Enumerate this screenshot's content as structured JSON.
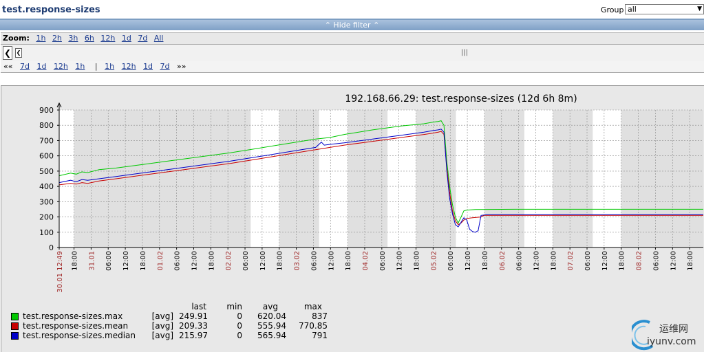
{
  "header": {
    "title": "test.response-sizes",
    "group_label": "Group",
    "group_value": "all"
  },
  "filterbar": {
    "label": "⌃ Hide filter ⌃"
  },
  "zoom": {
    "label": "Zoom:",
    "options": [
      "1h",
      "2h",
      "3h",
      "6h",
      "12h",
      "1d",
      "7d",
      "All"
    ]
  },
  "nav": {
    "back": "««",
    "back_options": [
      "7d",
      "1d",
      "12h",
      "1h"
    ],
    "separator": "|",
    "fwd_options": [
      "1h",
      "12h",
      "1d",
      "7d"
    ],
    "forward": "»»"
  },
  "colors": {
    "max": "#00c800",
    "mean": "#c80000",
    "median": "#0000c8",
    "day_label": "#a02828",
    "grid_band": "#e0e0e0"
  },
  "chart_data": {
    "type": "line",
    "title": "192.168.66.29: test.response-sizes (12d 6h 8m)",
    "ylim": [
      0,
      900
    ],
    "yticks": [
      0,
      100,
      200,
      300,
      400,
      500,
      600,
      700,
      800,
      900
    ],
    "grid": true,
    "xlabels": [
      {
        "t": 0.0,
        "text": "30.01 12:49",
        "day": true
      },
      {
        "t": 5.2,
        "text": "18:00",
        "day": false
      },
      {
        "t": 11.2,
        "text": "31.01",
        "day": true
      },
      {
        "t": 17.2,
        "text": "06:00",
        "day": false
      },
      {
        "t": 23.2,
        "text": "12:00",
        "day": false
      },
      {
        "t": 29.2,
        "text": "18:00",
        "day": false
      },
      {
        "t": 35.2,
        "text": "01.02",
        "day": true
      },
      {
        "t": 41.2,
        "text": "06:00",
        "day": false
      },
      {
        "t": 47.2,
        "text": "12:00",
        "day": false
      },
      {
        "t": 53.2,
        "text": "18:00",
        "day": false
      },
      {
        "t": 59.2,
        "text": "02.02",
        "day": true
      },
      {
        "t": 65.2,
        "text": "06:00",
        "day": false
      },
      {
        "t": 71.2,
        "text": "12:00",
        "day": false
      },
      {
        "t": 77.2,
        "text": "18:00",
        "day": false
      },
      {
        "t": 83.2,
        "text": "03.02",
        "day": true
      },
      {
        "t": 89.2,
        "text": "06:00",
        "day": false
      },
      {
        "t": 95.2,
        "text": "12:00",
        "day": false
      },
      {
        "t": 101.2,
        "text": "18:00",
        "day": false
      },
      {
        "t": 107.2,
        "text": "04.02",
        "day": true
      },
      {
        "t": 113.2,
        "text": "06:00",
        "day": false
      },
      {
        "t": 119.2,
        "text": "12:00",
        "day": false
      },
      {
        "t": 125.2,
        "text": "18:00",
        "day": false
      },
      {
        "t": 131.2,
        "text": "05.02",
        "day": true
      },
      {
        "t": 137.2,
        "text": "06:00",
        "day": false
      },
      {
        "t": 143.2,
        "text": "12:00",
        "day": false
      },
      {
        "t": 149.2,
        "text": "18:00",
        "day": false
      },
      {
        "t": 155.2,
        "text": "06.02",
        "day": true
      },
      {
        "t": 161.2,
        "text": "06:00",
        "day": false
      },
      {
        "t": 167.2,
        "text": "12:00",
        "day": false
      },
      {
        "t": 173.2,
        "text": "18:00",
        "day": false
      },
      {
        "t": 179.2,
        "text": "07.02",
        "day": true
      },
      {
        "t": 185.2,
        "text": "06:00",
        "day": false
      },
      {
        "t": 191.2,
        "text": "12:00",
        "day": false
      },
      {
        "t": 197.2,
        "text": "18:00",
        "day": false
      },
      {
        "t": 203.2,
        "text": "08.02",
        "day": true
      },
      {
        "t": 209.2,
        "text": "06:00",
        "day": false
      },
      {
        "t": 215.2,
        "text": "12:00",
        "day": false
      },
      {
        "t": 221.2,
        "text": "18:00",
        "day": false
      }
    ],
    "xlim": [
      0,
      226
    ],
    "bands": [
      [
        5.2,
        67.2
      ],
      [
        77.2,
        91.2
      ],
      [
        101.2,
        115.2
      ],
      [
        125.2,
        139.2
      ],
      [
        149.2,
        163.2
      ],
      [
        173.2,
        187.2
      ],
      [
        197.2,
        226
      ]
    ],
    "series": [
      {
        "name": "test.response-sizes.max",
        "key": "max",
        "points": [
          [
            0,
            470
          ],
          [
            4,
            487
          ],
          [
            6,
            480
          ],
          [
            8,
            495
          ],
          [
            10,
            490
          ],
          [
            14,
            510
          ],
          [
            20,
            520
          ],
          [
            30,
            545
          ],
          [
            40,
            570
          ],
          [
            50,
            595
          ],
          [
            60,
            620
          ],
          [
            70,
            650
          ],
          [
            80,
            680
          ],
          [
            90,
            710
          ],
          [
            95,
            720
          ],
          [
            100,
            740
          ],
          [
            110,
            770
          ],
          [
            120,
            795
          ],
          [
            128,
            810
          ],
          [
            131,
            820
          ],
          [
            133,
            825
          ],
          [
            134,
            830
          ],
          [
            135,
            800
          ],
          [
            136,
            560
          ],
          [
            137,
            400
          ],
          [
            138,
            280
          ],
          [
            139,
            200
          ],
          [
            140,
            160
          ],
          [
            141,
            200
          ],
          [
            142,
            240
          ],
          [
            143,
            245
          ],
          [
            146,
            249
          ],
          [
            160,
            250
          ],
          [
            226,
            250
          ]
        ]
      },
      {
        "name": "test.response-sizes.mean",
        "key": "mean",
        "points": [
          [
            0,
            410
          ],
          [
            4,
            420
          ],
          [
            6,
            415
          ],
          [
            8,
            425
          ],
          [
            10,
            420
          ],
          [
            14,
            435
          ],
          [
            20,
            450
          ],
          [
            30,
            475
          ],
          [
            40,
            500
          ],
          [
            50,
            525
          ],
          [
            60,
            550
          ],
          [
            70,
            580
          ],
          [
            80,
            610
          ],
          [
            90,
            640
          ],
          [
            95,
            655
          ],
          [
            100,
            670
          ],
          [
            110,
            695
          ],
          [
            120,
            720
          ],
          [
            128,
            740
          ],
          [
            131,
            748
          ],
          [
            133,
            755
          ],
          [
            134,
            760
          ],
          [
            135,
            740
          ],
          [
            136,
            520
          ],
          [
            137,
            360
          ],
          [
            138,
            240
          ],
          [
            139,
            175
          ],
          [
            140,
            150
          ],
          [
            141,
            160
          ],
          [
            142,
            180
          ],
          [
            143,
            190
          ],
          [
            145,
            195
          ],
          [
            148,
            200
          ],
          [
            149,
            210
          ],
          [
            160,
            210
          ],
          [
            226,
            210
          ]
        ]
      },
      {
        "name": "test.response-sizes.median",
        "key": "median",
        "points": [
          [
            0,
            425
          ],
          [
            4,
            440
          ],
          [
            6,
            430
          ],
          [
            8,
            445
          ],
          [
            10,
            440
          ],
          [
            14,
            450
          ],
          [
            20,
            465
          ],
          [
            30,
            490
          ],
          [
            40,
            515
          ],
          [
            50,
            540
          ],
          [
            60,
            565
          ],
          [
            70,
            595
          ],
          [
            80,
            625
          ],
          [
            90,
            655
          ],
          [
            92,
            690
          ],
          [
            93,
            670
          ],
          [
            95,
            675
          ],
          [
            100,
            685
          ],
          [
            110,
            710
          ],
          [
            120,
            735
          ],
          [
            128,
            755
          ],
          [
            131,
            765
          ],
          [
            133,
            770
          ],
          [
            134,
            775
          ],
          [
            135,
            755
          ],
          [
            136,
            500
          ],
          [
            137,
            320
          ],
          [
            138,
            220
          ],
          [
            139,
            150
          ],
          [
            140,
            135
          ],
          [
            141,
            165
          ],
          [
            142,
            195
          ],
          [
            143,
            180
          ],
          [
            144,
            120
          ],
          [
            145,
            105
          ],
          [
            146,
            100
          ],
          [
            147,
            110
          ],
          [
            148,
            210
          ],
          [
            150,
            215
          ],
          [
            160,
            215
          ],
          [
            226,
            215
          ]
        ]
      }
    ],
    "legend": {
      "headers": [
        "last",
        "min",
        "avg",
        "max"
      ],
      "rows": [
        {
          "name": "test.response-sizes.max",
          "agg": "[avg]",
          "last": "249.91",
          "min": "0",
          "avg": "620.04",
          "max": "837"
        },
        {
          "name": "test.response-sizes.mean",
          "agg": "[avg]",
          "last": "209.33",
          "min": "0",
          "avg": "555.94",
          "max": "770.85"
        },
        {
          "name": "test.response-sizes.median",
          "agg": "[avg]",
          "last": "215.97",
          "min": "0",
          "avg": "565.94",
          "max": "791"
        }
      ]
    }
  },
  "watermark": {
    "cn": "运维网",
    "en": "iyunv.com"
  }
}
